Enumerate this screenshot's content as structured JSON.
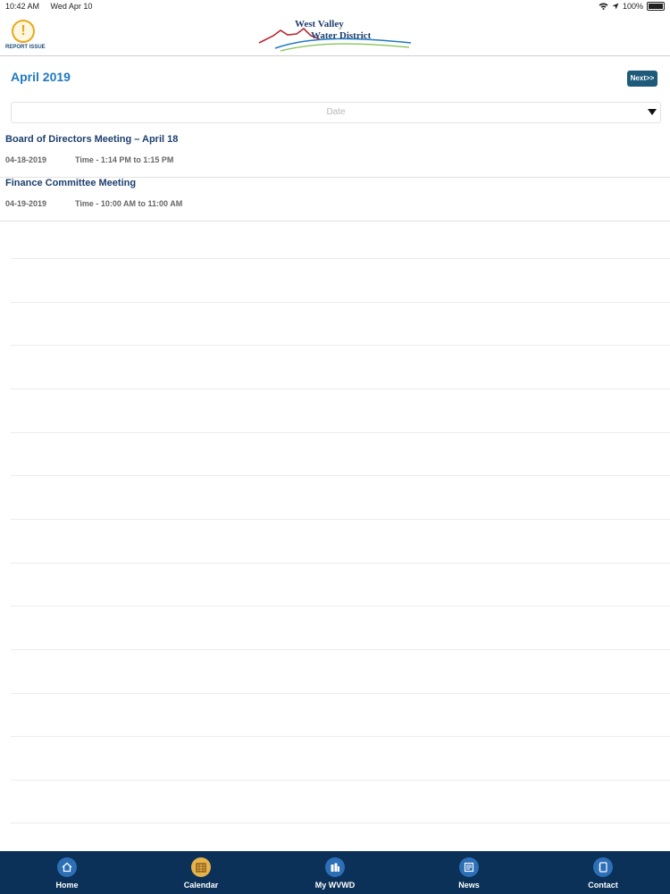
{
  "status": {
    "time": "10:42 AM",
    "date": "Wed Apr 10",
    "battery": "100%"
  },
  "header": {
    "report_label": "REPORT ISSUE",
    "report_symbol": "!",
    "logo_line1": "West Valley",
    "logo_line2": "Water District"
  },
  "calendar": {
    "month_title": "April 2019",
    "next_label": "Next>>",
    "date_placeholder": "Date"
  },
  "events": [
    {
      "title": "Board of Directors Meeting – April 18",
      "date": "04-18-2019",
      "time": "Time - 1:14 PM to 1:15 PM"
    },
    {
      "title": "Finance Committee Meeting",
      "date": "04-19-2019",
      "time": "Time - 10:00 AM to 11:00 AM"
    }
  ],
  "tabs": [
    {
      "label": "Home",
      "icon": "home-icon"
    },
    {
      "label": "Calendar",
      "icon": "calendar-icon",
      "active": true
    },
    {
      "label": "My WVWD",
      "icon": "buildings-icon"
    },
    {
      "label": "News",
      "icon": "newspaper-icon"
    },
    {
      "label": "Contact",
      "icon": "contact-book-icon"
    }
  ],
  "colors": {
    "accent": "#1f79c0",
    "tabbar": "#0b3158",
    "tab_active": "#e6b24a",
    "next_button": "#1e5a7a"
  }
}
